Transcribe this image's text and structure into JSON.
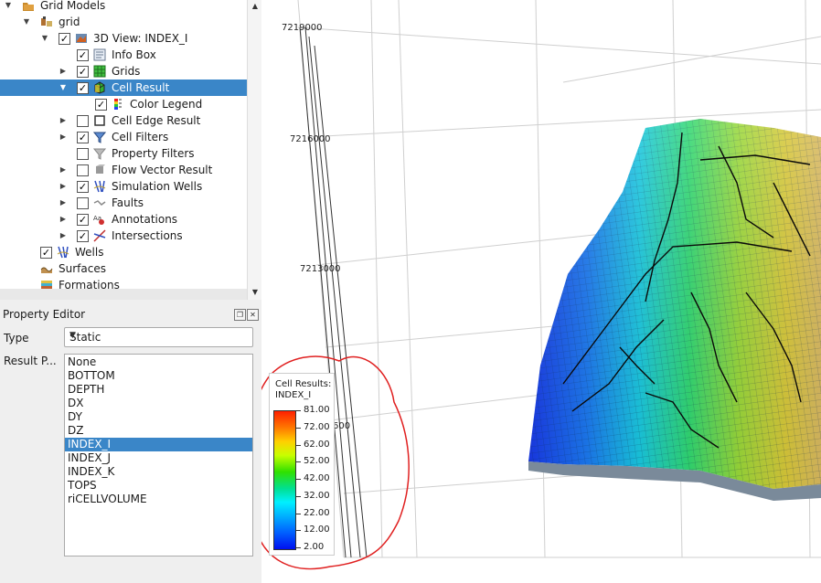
{
  "tree": {
    "items": [
      {
        "label": "Grid Models",
        "icon": "folder-models-icon",
        "checkbox": null,
        "arrow": "down"
      },
      {
        "label": "grid",
        "icon": "grid-model-icon",
        "checkbox": null,
        "arrow": "down"
      },
      {
        "label": "3D View: INDEX_I",
        "icon": "3d-view-icon",
        "checkbox": true,
        "arrow": "down"
      },
      {
        "label": "Info Box",
        "icon": "info-box-icon",
        "checkbox": true,
        "arrow": null
      },
      {
        "label": "Grids",
        "icon": "grids-icon",
        "checkbox": true,
        "arrow": "right"
      },
      {
        "label": "Cell Result",
        "icon": "cell-result-icon",
        "checkbox": true,
        "arrow": "down",
        "selected": true
      },
      {
        "label": "Color Legend",
        "icon": "color-legend-icon",
        "checkbox": true,
        "arrow": null
      },
      {
        "label": "Cell Edge Result",
        "icon": "cell-edge-icon",
        "checkbox": false,
        "arrow": "right"
      },
      {
        "label": "Cell Filters",
        "icon": "filter-icon",
        "checkbox": true,
        "arrow": "right"
      },
      {
        "label": "Property Filters",
        "icon": "property-filter-icon",
        "checkbox": false,
        "arrow": null
      },
      {
        "label": "Flow Vector Result",
        "icon": "flow-vector-icon",
        "checkbox": false,
        "arrow": "right"
      },
      {
        "label": "Simulation Wells",
        "icon": "simulation-wells-icon",
        "checkbox": true,
        "arrow": "right"
      },
      {
        "label": "Faults",
        "icon": "faults-icon",
        "checkbox": false,
        "arrow": "right"
      },
      {
        "label": "Annotations",
        "icon": "annotations-icon",
        "checkbox": true,
        "arrow": "right"
      },
      {
        "label": "Intersections",
        "icon": "intersections-icon",
        "checkbox": true,
        "arrow": "right"
      },
      {
        "label": "Wells",
        "icon": "wells-icon",
        "checkbox": true,
        "arrow": null
      },
      {
        "label": "Surfaces",
        "icon": "surfaces-icon",
        "checkbox": null,
        "arrow": null
      },
      {
        "label": "Formations",
        "icon": "formations-icon",
        "checkbox": null,
        "arrow": null
      }
    ]
  },
  "property_editor": {
    "title": "Property Editor",
    "type_label": "Type",
    "type_value": "Static",
    "result_label": "Result P...",
    "results": [
      "None",
      "BOTTOM",
      "DEPTH",
      "DX",
      "DY",
      "DZ",
      "INDEX_I",
      "INDEX_J",
      "INDEX_K",
      "TOPS",
      "riCELLVOLUME"
    ],
    "selected_result": "INDEX_I"
  },
  "legend": {
    "title_line1": "Cell Results:",
    "title_line2": "INDEX_I",
    "ticks": [
      "81.00",
      "72.00",
      "62.00",
      "52.00",
      "42.00",
      "32.00",
      "22.00",
      "12.00",
      "2.00"
    ]
  },
  "view": {
    "coord_labels": [
      "7219000",
      "7216000",
      "7213000",
      "600"
    ]
  },
  "colors": {
    "selection": "#3a86c8",
    "annotation_circle": "#e02020"
  }
}
